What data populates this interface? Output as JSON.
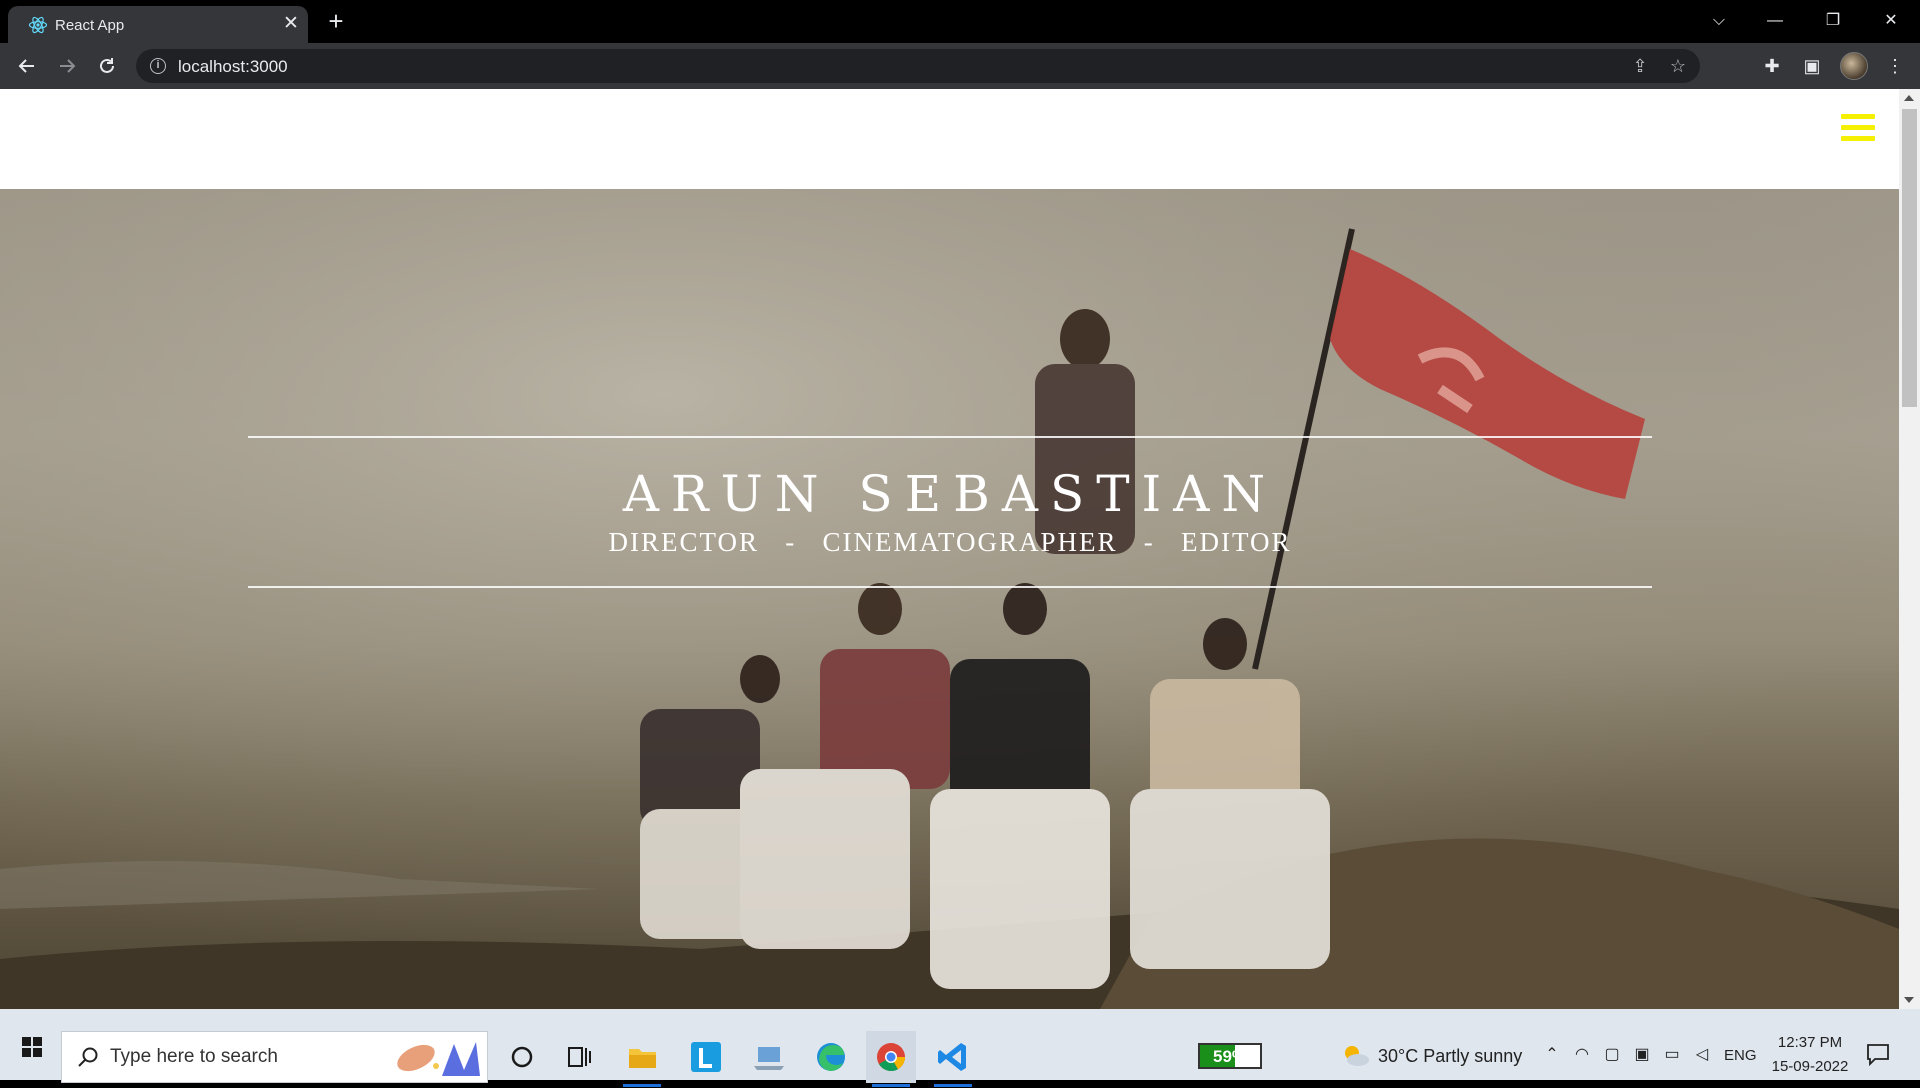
{
  "browser": {
    "tab_title": "React App",
    "tab_close": "✕",
    "new_tab": "+",
    "url": "localhost:3000",
    "window_controls": {
      "dropdown": "⌵",
      "minimize": "—",
      "restore": "❐",
      "close": "✕"
    }
  },
  "site": {
    "hero_title": "ARUN SEBASTIAN",
    "hero_subtitle": "DIRECTOR   -   CINEMATOGRAPHER   -   EDITOR",
    "menu_color": "#f5f000"
  },
  "taskbar": {
    "search_placeholder": "Type here to search",
    "battery_text": "59%",
    "battery_level": 59,
    "weather": "30°C  Partly sunny",
    "language": "ENG",
    "time": "12:37 PM",
    "date": "15-09-2022"
  }
}
